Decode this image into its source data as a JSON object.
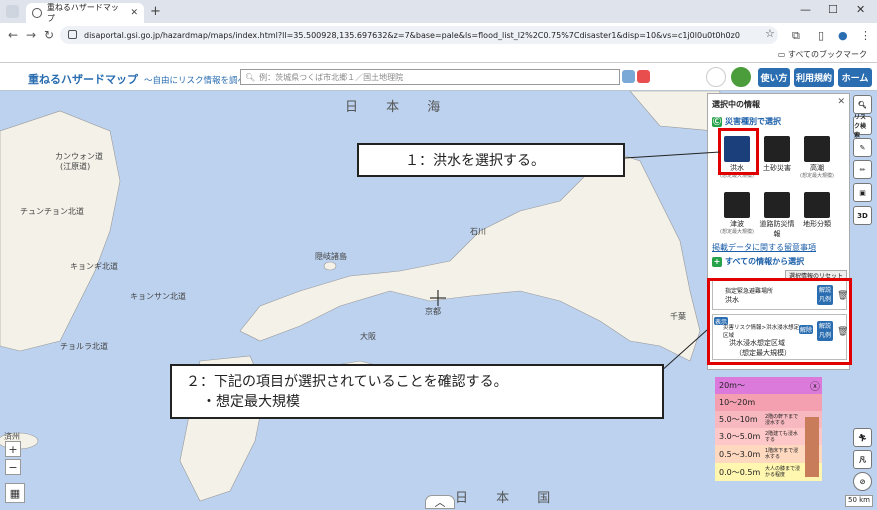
{
  "browser": {
    "tab_title": "重ねるハザードマップ",
    "url": "disaportal.gsi.go.jp/hazardmap/maps/index.html?ll=35.500928,135.697632&z=7&base=pale&ls=flood_list_l2%2C0.75%7Cdisaster1&disp=10&vs=c1j0l0u0t0h0z0",
    "bookmarks_label": "すべてのブックマーク"
  },
  "app": {
    "title": "重ねるハザードマップ",
    "subtitle": "〜自由にリスク情報を調べる〜",
    "search_placeholder": "例：茨城県つくば市北郷１／国土地理院",
    "buttons": {
      "howto": "使い方",
      "terms": "利用規約",
      "home": "ホーム"
    }
  },
  "map_labels": {
    "sea_japan": "日 本 海",
    "land_japan": "日 本 国",
    "places": [
      "カンウォン道",
      "(江原道)",
      "チュンチョン北道",
      "キョンギ北道",
      "キョンサン北道",
      "チョルラ北道",
      "隠岐諸島",
      "石川",
      "京都",
      "千葉",
      "大阪",
      "済州"
    ]
  },
  "panel": {
    "title": "選択中の情報",
    "by_type_label": "災害種別で選択",
    "disasters": [
      {
        "label": "洪水",
        "sub": "(想定最大規模)"
      },
      {
        "label": "土砂災害",
        "sub": ""
      },
      {
        "label": "高潮",
        "sub": "(想定最大規模)"
      },
      {
        "label": "津波",
        "sub": "(想定最大規模)"
      },
      {
        "label": "道路防災情報",
        "sub": ""
      },
      {
        "label": "地形分類",
        "sub": ""
      }
    ],
    "notice_link": "掲載データに関する留意事項",
    "all_info_label": "すべての情報から選択",
    "reset_label": "選択情報のリセット",
    "layer1": {
      "category": "指定緊急避難場所",
      "name": "洪水",
      "btn": "解説 凡例"
    },
    "layer2": {
      "tag": "表示",
      "category": "災害リスク情報>洪水浸水想定区域",
      "name": "洪水浸水想定区域",
      "sub": "（想定最大規模）",
      "btn_hide": "解除",
      "btn": "解説 凡例"
    }
  },
  "legend": {
    "rows": [
      {
        "label": "20m〜",
        "color": "#dc7adc"
      },
      {
        "label": "10〜20m",
        "color": "#f5a0b0"
      },
      {
        "label": "5.0〜10m",
        "color": "#f7b8c0"
      },
      {
        "label": "3.0〜5.0m",
        "color": "#ffc8c8"
      },
      {
        "label": "0.5〜3.0m",
        "color": "#ffd8c0"
      },
      {
        "label": "0.0〜0.5m",
        "color": "#fff6b0"
      }
    ],
    "notes": [
      "2階の軒下まで浸水する",
      "2階建ても浸水する",
      "1階床下まで浸水する",
      "大人の膝まで浸かる程度"
    ]
  },
  "callouts": {
    "step1": "１：洪水を選択する。",
    "step2_line1": "２：下記の項目が選択されていることを確認する。",
    "step2_line2": "・想定最大規模"
  },
  "tools": [
    "リスク検索",
    "3D"
  ],
  "scale": "50 km",
  "colors": {
    "accent": "#2a6db0",
    "highlight": "#e00000",
    "sea": "#bcd2ef",
    "land": "#f4f1e8"
  }
}
